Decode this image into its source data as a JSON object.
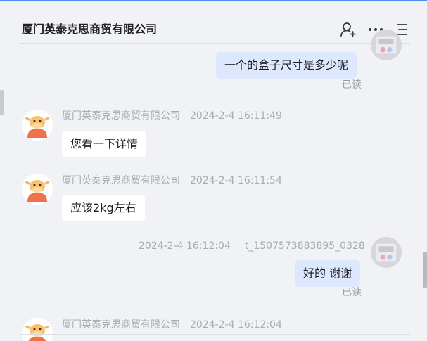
{
  "header": {
    "title": "厦门英泰克思商贸有限公司",
    "icons": [
      "add-contact-icon",
      "more-icon",
      "menu-icon"
    ]
  },
  "messages": [
    {
      "side": "right",
      "text": "一个的盒子尺寸是多少呢",
      "status": "已读"
    },
    {
      "side": "left",
      "sender": "厦门英泰克思商贸有限公司",
      "time": "2024-2-4 16:11:49",
      "text": "您看一下详情"
    },
    {
      "side": "left",
      "sender": "厦门英泰克思商贸有限公司",
      "time": "2024-2-4 16:11:54",
      "text": "应该2kg左右"
    },
    {
      "side": "right",
      "sender": "t_1507573883895_0328",
      "time": "2024-2-4 16:12:04",
      "text": "好的 谢谢",
      "status": "已读"
    },
    {
      "side": "left",
      "sender": "厦门英泰克思商贸有限公司",
      "time": "2024-2-4 16:12:04"
    }
  ],
  "colors": {
    "background": "#f1f2f6",
    "bubble_left": "#ffffff",
    "bubble_right": "#dde8ff",
    "accent": "#4a8cf0"
  }
}
